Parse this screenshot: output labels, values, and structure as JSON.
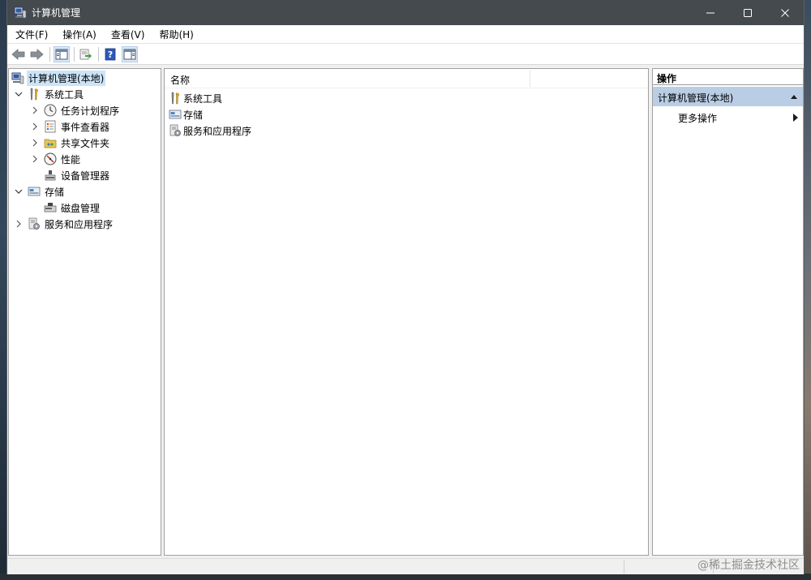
{
  "window": {
    "title": "计算机管理",
    "controls": {
      "minimize": "—",
      "maximize": "☐",
      "close": "✕"
    }
  },
  "menubar": {
    "items": [
      "文件(F)",
      "操作(A)",
      "查看(V)",
      "帮助(H)"
    ]
  },
  "toolbar": {
    "buttons": [
      "back-icon",
      "forward-icon",
      "show-hide-tree-icon",
      "export-list-icon",
      "help-icon",
      "show-hide-action-pane-icon"
    ]
  },
  "tree": {
    "root": "计算机管理(本地)",
    "items": [
      {
        "label": "系统工具",
        "expanded": true
      },
      {
        "label": "任务计划程序"
      },
      {
        "label": "事件查看器"
      },
      {
        "label": "共享文件夹"
      },
      {
        "label": "性能"
      },
      {
        "label": "设备管理器"
      },
      {
        "label": "存储",
        "expanded": true
      },
      {
        "label": "磁盘管理"
      },
      {
        "label": "服务和应用程序"
      }
    ]
  },
  "center": {
    "column_header": "名称",
    "rows": [
      "系统工具",
      "存储",
      "服务和应用程序"
    ]
  },
  "actions": {
    "header": "操作",
    "group": "计算机管理(本地)",
    "items": [
      "更多操作"
    ]
  },
  "watermark": "@稀土掘金技术社区",
  "colors": {
    "titlebar": "#454a4f",
    "selection": "#cce4f7",
    "action_group": "#b9cde4"
  }
}
